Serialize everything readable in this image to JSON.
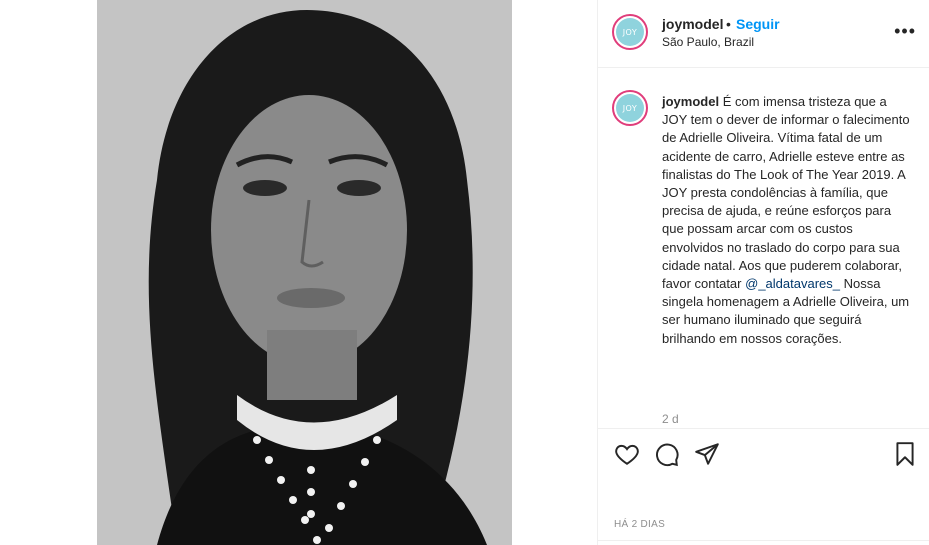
{
  "post": {
    "username": "joymodel",
    "separator": "•",
    "follow_label": "Seguir",
    "location": "São Paulo, Brazil",
    "more_label": "•••",
    "avatar_text": "JOY",
    "caption_user": "joymodel",
    "caption_part1": "É com imensa tristeza que a JOY tem o dever de informar o falecimento de Adrielle Oliveira. Vítima fatal de um acidente de carro, Adrielle esteve entre as finalistas do The Look of The Year 2019. A JOY presta condolências à família, que precisa de ajuda, e reúne esforços para que possam arcar com os custos envolvidos no traslado do corpo para sua cidade natal. Aos que puderem colaborar, favor contatar",
    "caption_mention": "@_aldatavares_",
    "caption_part2": "Nossa singela homenagem a Adrielle Oliveira, um ser humano iluminado que seguirá brilhando em nossos corações.",
    "caption_time": "2 d",
    "date_label": "HÁ 2 DIAS"
  },
  "icons": {
    "like": "heart-icon",
    "comment": "comment-icon",
    "share": "paper-plane-icon",
    "save": "bookmark-icon",
    "more": "more-options-icon"
  },
  "colors": {
    "follow": "#0095f6",
    "avatar_ring": "#e03d7b",
    "avatar_fill": "#8fd3dd",
    "muted": "#8e8e8e"
  }
}
